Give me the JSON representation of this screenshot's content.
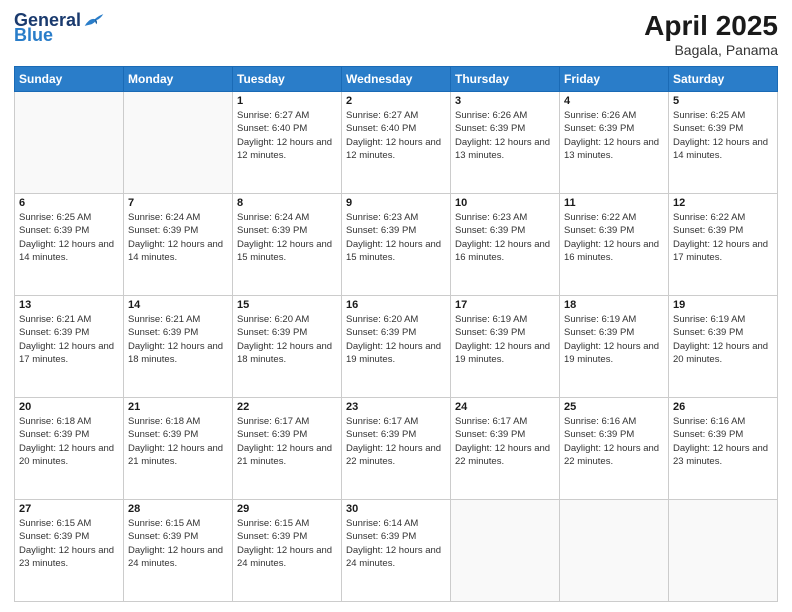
{
  "header": {
    "logo_general": "General",
    "logo_blue": "Blue",
    "title": "April 2025",
    "location": "Bagala, Panama"
  },
  "weekdays": [
    "Sunday",
    "Monday",
    "Tuesday",
    "Wednesday",
    "Thursday",
    "Friday",
    "Saturday"
  ],
  "weeks": [
    [
      {
        "day": "",
        "info": ""
      },
      {
        "day": "",
        "info": ""
      },
      {
        "day": "1",
        "info": "Sunrise: 6:27 AM\nSunset: 6:40 PM\nDaylight: 12 hours and 12 minutes."
      },
      {
        "day": "2",
        "info": "Sunrise: 6:27 AM\nSunset: 6:40 PM\nDaylight: 12 hours and 12 minutes."
      },
      {
        "day": "3",
        "info": "Sunrise: 6:26 AM\nSunset: 6:39 PM\nDaylight: 12 hours and 13 minutes."
      },
      {
        "day": "4",
        "info": "Sunrise: 6:26 AM\nSunset: 6:39 PM\nDaylight: 12 hours and 13 minutes."
      },
      {
        "day": "5",
        "info": "Sunrise: 6:25 AM\nSunset: 6:39 PM\nDaylight: 12 hours and 14 minutes."
      }
    ],
    [
      {
        "day": "6",
        "info": "Sunrise: 6:25 AM\nSunset: 6:39 PM\nDaylight: 12 hours and 14 minutes."
      },
      {
        "day": "7",
        "info": "Sunrise: 6:24 AM\nSunset: 6:39 PM\nDaylight: 12 hours and 14 minutes."
      },
      {
        "day": "8",
        "info": "Sunrise: 6:24 AM\nSunset: 6:39 PM\nDaylight: 12 hours and 15 minutes."
      },
      {
        "day": "9",
        "info": "Sunrise: 6:23 AM\nSunset: 6:39 PM\nDaylight: 12 hours and 15 minutes."
      },
      {
        "day": "10",
        "info": "Sunrise: 6:23 AM\nSunset: 6:39 PM\nDaylight: 12 hours and 16 minutes."
      },
      {
        "day": "11",
        "info": "Sunrise: 6:22 AM\nSunset: 6:39 PM\nDaylight: 12 hours and 16 minutes."
      },
      {
        "day": "12",
        "info": "Sunrise: 6:22 AM\nSunset: 6:39 PM\nDaylight: 12 hours and 17 minutes."
      }
    ],
    [
      {
        "day": "13",
        "info": "Sunrise: 6:21 AM\nSunset: 6:39 PM\nDaylight: 12 hours and 17 minutes."
      },
      {
        "day": "14",
        "info": "Sunrise: 6:21 AM\nSunset: 6:39 PM\nDaylight: 12 hours and 18 minutes."
      },
      {
        "day": "15",
        "info": "Sunrise: 6:20 AM\nSunset: 6:39 PM\nDaylight: 12 hours and 18 minutes."
      },
      {
        "day": "16",
        "info": "Sunrise: 6:20 AM\nSunset: 6:39 PM\nDaylight: 12 hours and 19 minutes."
      },
      {
        "day": "17",
        "info": "Sunrise: 6:19 AM\nSunset: 6:39 PM\nDaylight: 12 hours and 19 minutes."
      },
      {
        "day": "18",
        "info": "Sunrise: 6:19 AM\nSunset: 6:39 PM\nDaylight: 12 hours and 19 minutes."
      },
      {
        "day": "19",
        "info": "Sunrise: 6:19 AM\nSunset: 6:39 PM\nDaylight: 12 hours and 20 minutes."
      }
    ],
    [
      {
        "day": "20",
        "info": "Sunrise: 6:18 AM\nSunset: 6:39 PM\nDaylight: 12 hours and 20 minutes."
      },
      {
        "day": "21",
        "info": "Sunrise: 6:18 AM\nSunset: 6:39 PM\nDaylight: 12 hours and 21 minutes."
      },
      {
        "day": "22",
        "info": "Sunrise: 6:17 AM\nSunset: 6:39 PM\nDaylight: 12 hours and 21 minutes."
      },
      {
        "day": "23",
        "info": "Sunrise: 6:17 AM\nSunset: 6:39 PM\nDaylight: 12 hours and 22 minutes."
      },
      {
        "day": "24",
        "info": "Sunrise: 6:17 AM\nSunset: 6:39 PM\nDaylight: 12 hours and 22 minutes."
      },
      {
        "day": "25",
        "info": "Sunrise: 6:16 AM\nSunset: 6:39 PM\nDaylight: 12 hours and 22 minutes."
      },
      {
        "day": "26",
        "info": "Sunrise: 6:16 AM\nSunset: 6:39 PM\nDaylight: 12 hours and 23 minutes."
      }
    ],
    [
      {
        "day": "27",
        "info": "Sunrise: 6:15 AM\nSunset: 6:39 PM\nDaylight: 12 hours and 23 minutes."
      },
      {
        "day": "28",
        "info": "Sunrise: 6:15 AM\nSunset: 6:39 PM\nDaylight: 12 hours and 24 minutes."
      },
      {
        "day": "29",
        "info": "Sunrise: 6:15 AM\nSunset: 6:39 PM\nDaylight: 12 hours and 24 minutes."
      },
      {
        "day": "30",
        "info": "Sunrise: 6:14 AM\nSunset: 6:39 PM\nDaylight: 12 hours and 24 minutes."
      },
      {
        "day": "",
        "info": ""
      },
      {
        "day": "",
        "info": ""
      },
      {
        "day": "",
        "info": ""
      }
    ]
  ]
}
